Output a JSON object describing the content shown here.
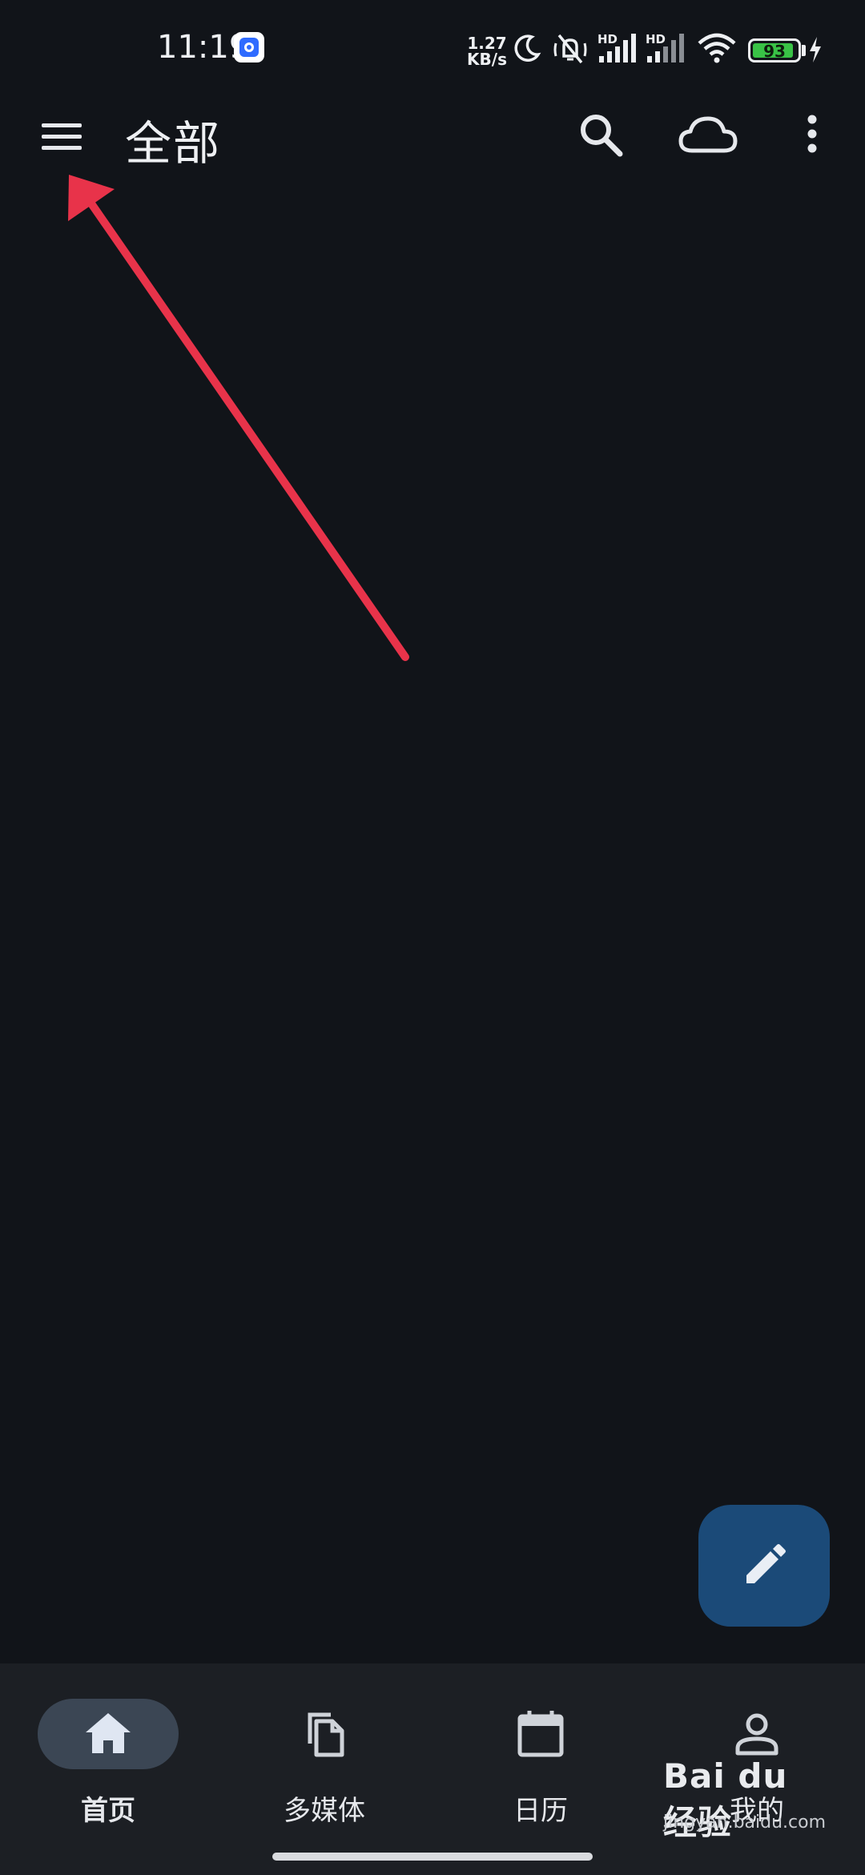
{
  "status_bar": {
    "time": "11:19",
    "net_speed_value": "1.27",
    "net_speed_unit": "KB/s",
    "signal_1_label": "HD",
    "signal_2_label": "HD",
    "battery_level": "93",
    "battery_fraction": 0.93,
    "icons": [
      "app-notification-icon",
      "moon-icon",
      "mute-vibrate-icon",
      "signal-icon",
      "signal-icon",
      "wifi-icon",
      "battery-icon",
      "charging-bolt-icon"
    ]
  },
  "app_bar": {
    "title": "全部",
    "icons": [
      "menu-icon",
      "search-icon",
      "cloud-icon",
      "more-vert-icon"
    ]
  },
  "fab": {
    "icon": "edit-pencil-icon"
  },
  "bottom_nav": {
    "items": [
      {
        "label": "首页",
        "icon": "home-icon",
        "active": true
      },
      {
        "label": "多媒体",
        "icon": "copy-files-icon",
        "active": false
      },
      {
        "label": "日历",
        "icon": "calendar-icon",
        "active": false
      },
      {
        "label": "我的",
        "icon": "person-icon",
        "active": false
      }
    ]
  },
  "watermark": {
    "brand": "Bai du 经验",
    "url": "jingyan.baidu.com"
  },
  "colors": {
    "background": "#111419",
    "nav_background": "#1c1f24",
    "active_pill": "#3b4654",
    "fab": "#1b4a78",
    "annotation_arrow": "#e8334a",
    "battery_fill": "#39c246"
  }
}
